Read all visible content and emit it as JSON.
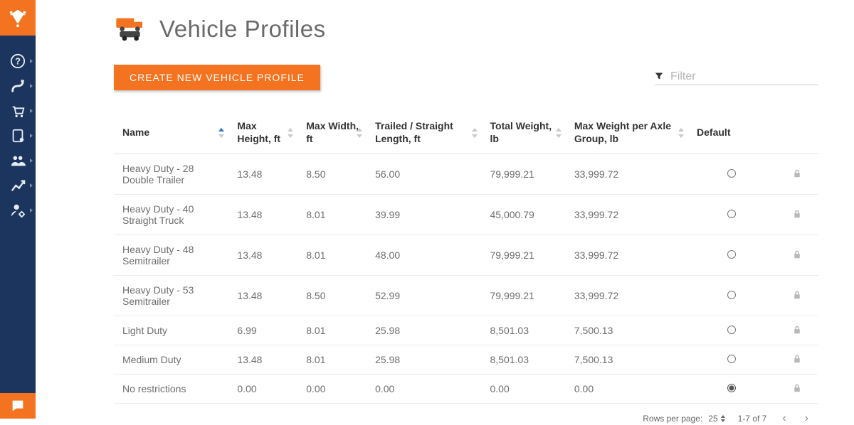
{
  "page": {
    "title": "Vehicle Profiles"
  },
  "toolbar": {
    "create_label": "CREATE NEW VEHICLE PROFILE"
  },
  "filter": {
    "placeholder": "Filter",
    "value": ""
  },
  "table": {
    "columns": {
      "name": "Name",
      "height": "Max Height, ft",
      "width": "Max Width, ft",
      "length": "Trailed / Straight Length, ft",
      "total": "Total Weight, lb",
      "axle": "Max Weight per Axle Group, lb",
      "default": "Default"
    },
    "rows": [
      {
        "name": "Heavy Duty - 28 Double Trailer",
        "height": "13.48",
        "width": "8.50",
        "length": "56.00",
        "total": "79,999.21",
        "axle": "33,999.72",
        "default": false,
        "locked": true
      },
      {
        "name": "Heavy Duty - 40 Straight Truck",
        "height": "13.48",
        "width": "8.01",
        "length": "39.99",
        "total": "45,000.79",
        "axle": "33,999.72",
        "default": false,
        "locked": true
      },
      {
        "name": "Heavy Duty - 48 Semitrailer",
        "height": "13.48",
        "width": "8.01",
        "length": "48.00",
        "total": "79,999.21",
        "axle": "33,999.72",
        "default": false,
        "locked": true
      },
      {
        "name": "Heavy Duty - 53 Semitrailer",
        "height": "13.48",
        "width": "8.50",
        "length": "52.99",
        "total": "79,999.21",
        "axle": "33,999.72",
        "default": false,
        "locked": true
      },
      {
        "name": "Light Duty",
        "height": "6.99",
        "width": "8.01",
        "length": "25.98",
        "total": "8,501.03",
        "axle": "7,500.13",
        "default": false,
        "locked": true
      },
      {
        "name": "Medium Duty",
        "height": "13.48",
        "width": "8.01",
        "length": "25.98",
        "total": "8,501.03",
        "axle": "7,500.13",
        "default": false,
        "locked": true
      },
      {
        "name": "No restrictions",
        "height": "0.00",
        "width": "0.00",
        "length": "0.00",
        "total": "0.00",
        "axle": "0.00",
        "default": true,
        "locked": true
      }
    ]
  },
  "pager": {
    "rows_label": "Rows per page:",
    "rows_value": "25",
    "range": "1-7 of 7",
    "prev": "‹",
    "next": "›"
  },
  "sidebar": {
    "items": [
      {
        "name": "help-icon"
      },
      {
        "name": "routes-icon"
      },
      {
        "name": "orders-icon"
      },
      {
        "name": "addressbook-icon"
      },
      {
        "name": "team-icon"
      },
      {
        "name": "analytics-icon"
      },
      {
        "name": "user-settings-icon"
      }
    ]
  }
}
